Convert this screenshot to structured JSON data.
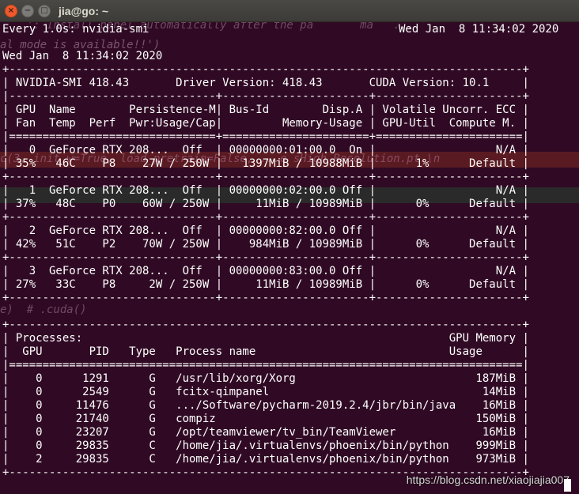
{
  "window": {
    "title": "jia@go: ~",
    "close_glyph": "×",
    "min_glyph": "−",
    "max_glyph": "□"
  },
  "colors": {
    "terminal_bg": "#300a24",
    "row_highlight_red": "#5a1a22",
    "row_highlight_gray": "#2a2a2a"
  },
  "terminal": {
    "header_left": "Every 1.0s: nvidia-smi",
    "header_right": "Wed Jan  8 11:34:02 2020",
    "background_text": {
      "line1": "    ': Install panel automatically after the pa       ma   ...",
      "line2": "al mode is available!!')",
      "line3": "c(3, init_w=True, load_pretrain=False, ...e sHigh Resolution.pt.\\n",
      "line4": "e)  # .cuda()"
    },
    "lines": [
      "Wed Jan  8 11:34:02 2020",
      "+-----------------------------------------------------------------------------+",
      "| NVIDIA-SMI 418.43       Driver Version: 418.43       CUDA Version: 10.1     |",
      "|-------------------------------+----------------------+----------------------+",
      "| GPU  Name        Persistence-M| Bus-Id        Disp.A | Volatile Uncorr. ECC |",
      "| Fan  Temp  Perf  Pwr:Usage/Cap|         Memory-Usage | GPU-Util  Compute M. |",
      "|===============================+======================+======================|",
      "|   0  GeForce RTX 208...  Off  | 00000000:01:00.0  On |                  N/A |",
      "| 35%   46C    P8    27W / 250W |   1397MiB / 10988MiB |      1%      Default |",
      "+-------------------------------+----------------------+----------------------+",
      "|   1  GeForce RTX 208...  Off  | 00000000:02:00.0 Off |                  N/A |",
      "| 37%   48C    P0    60W / 250W |     11MiB / 10989MiB |      0%      Default |",
      "+-------------------------------+----------------------+----------------------+",
      "|   2  GeForce RTX 208...  Off  | 00000000:82:00.0 Off |                  N/A |",
      "| 42%   51C    P2    70W / 250W |    984MiB / 10989MiB |      0%      Default |",
      "+-------------------------------+----------------------+----------------------+",
      "|   3  GeForce RTX 208...  Off  | 00000000:83:00.0 Off |                  N/A |",
      "| 27%   33C    P8     2W / 250W |     11MiB / 10989MiB |      0%      Default |",
      "+-------------------------------+----------------------+----------------------+",
      "",
      "+-----------------------------------------------------------------------------+",
      "| Processes:                                                       GPU Memory |",
      "|  GPU       PID   Type   Process name                             Usage      |",
      "|=============================================================================|",
      "|    0      1291      G   /usr/lib/xorg/Xorg                           187MiB |",
      "|    0      2549      G   fcitx-qimpanel                                14MiB |",
      "|    0     11476      G   .../Software/pycharm-2019.2.4/jbr/bin/java    16MiB |",
      "|    0     21740      G   compiz                                       150MiB |",
      "|    0     23207      G   /opt/teamviewer/tv_bin/TeamViewer             16MiB |",
      "|    0     29835      C   /home/jia/.virtualenvs/phoenix/bin/python    999MiB |",
      "|    2     29835      C   /home/jia/.virtualenvs/phoenix/bin/python    973MiB |",
      "+-----------------------------------------------------------------------------+"
    ]
  },
  "watermark": "https://blog.csdn.net/xiaojiajia007"
}
